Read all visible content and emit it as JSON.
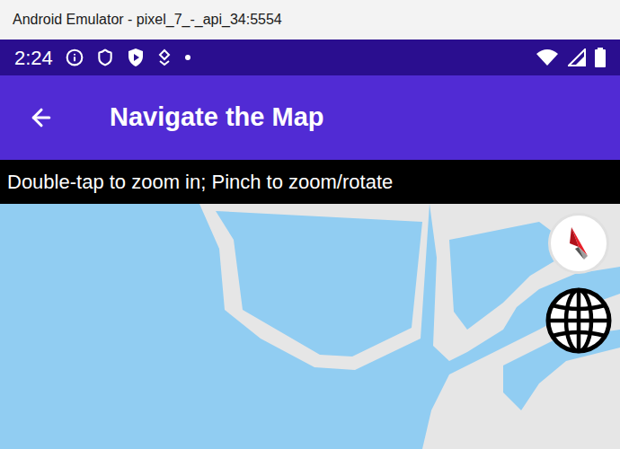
{
  "window": {
    "title": "Android Emulator - pixel_7_-_api_34:5554"
  },
  "status_bar": {
    "time": "2:24"
  },
  "app_bar": {
    "title": "Navigate the Map"
  },
  "instructions": {
    "text": "Double-tap to zoom in; Pinch to zoom/rotate"
  }
}
